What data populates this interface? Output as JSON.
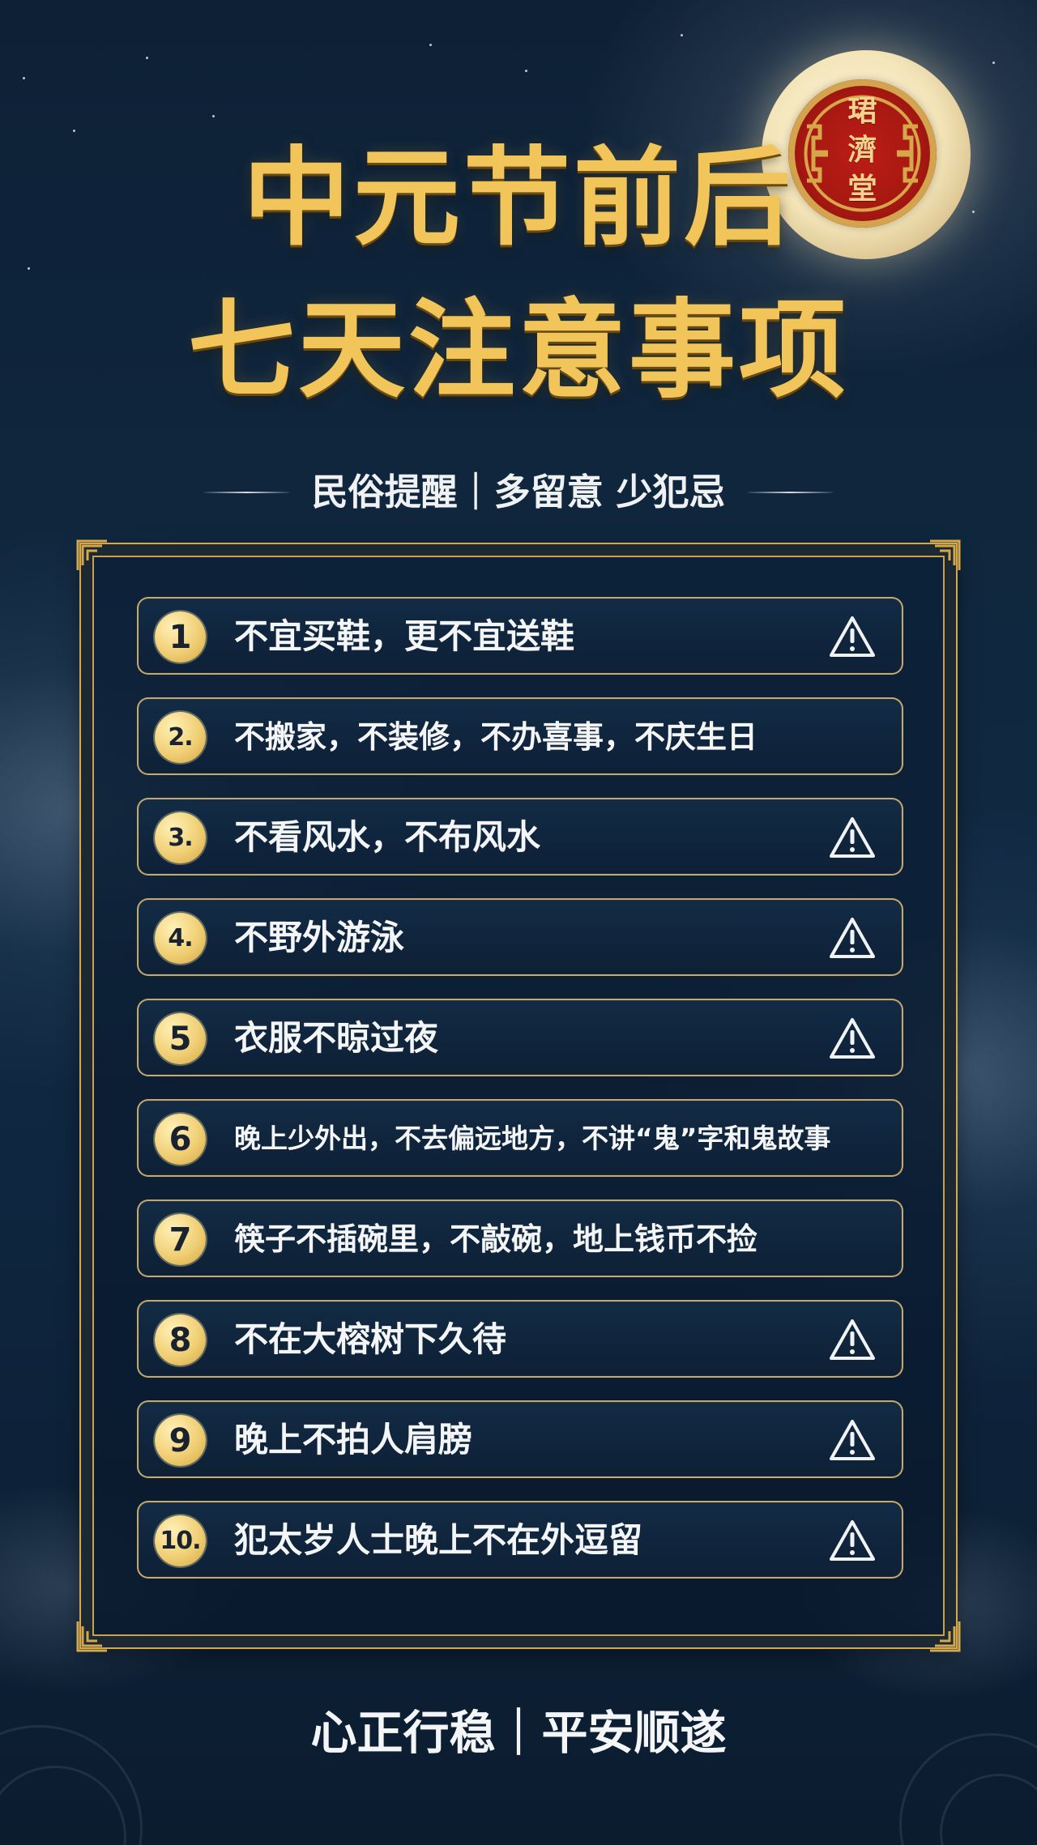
{
  "seal": {
    "chars": [
      "珺",
      "濟",
      "堂"
    ]
  },
  "title": {
    "line1": "中元节前后",
    "line2": "七天注意事项"
  },
  "subtitle": "民俗提醒｜多留意 少犯忌",
  "items": [
    {
      "number": "1",
      "text": "不宜买鞋，更不宜送鞋",
      "warning": true
    },
    {
      "number": "2.",
      "text": "不搬家，不装修，不办喜事，不庆生日",
      "warning": false
    },
    {
      "number": "3.",
      "text": "不看风水，不布风水",
      "warning": true
    },
    {
      "number": "4.",
      "text": "不野外游泳",
      "warning": true
    },
    {
      "number": "5",
      "text": "衣服不晾过夜",
      "warning": true
    },
    {
      "number": "6",
      "text": "晚上少外出，不去偏远地方，不讲“鬼”字和鬼故事",
      "warning": false
    },
    {
      "number": "7",
      "text": "筷子不插碗里，不敲碗，地上钱币不捡",
      "warning": false
    },
    {
      "number": "8",
      "text": "不在大榕树下久待",
      "warning": true
    },
    {
      "number": "9",
      "text": "晚上不拍人肩膀",
      "warning": true
    },
    {
      "number": "10.",
      "text": "犯太岁人士晚上不在外逗留",
      "warning": true
    }
  ],
  "footer": "心正行稳｜平安顺遂",
  "colors": {
    "gold": "#f2c55a",
    "navy": "#0f2741",
    "seal_red": "#a3170f"
  },
  "icons": {
    "seal": "seal-icon",
    "warning": "warning-icon",
    "corner": "ornament-corner-icon"
  }
}
